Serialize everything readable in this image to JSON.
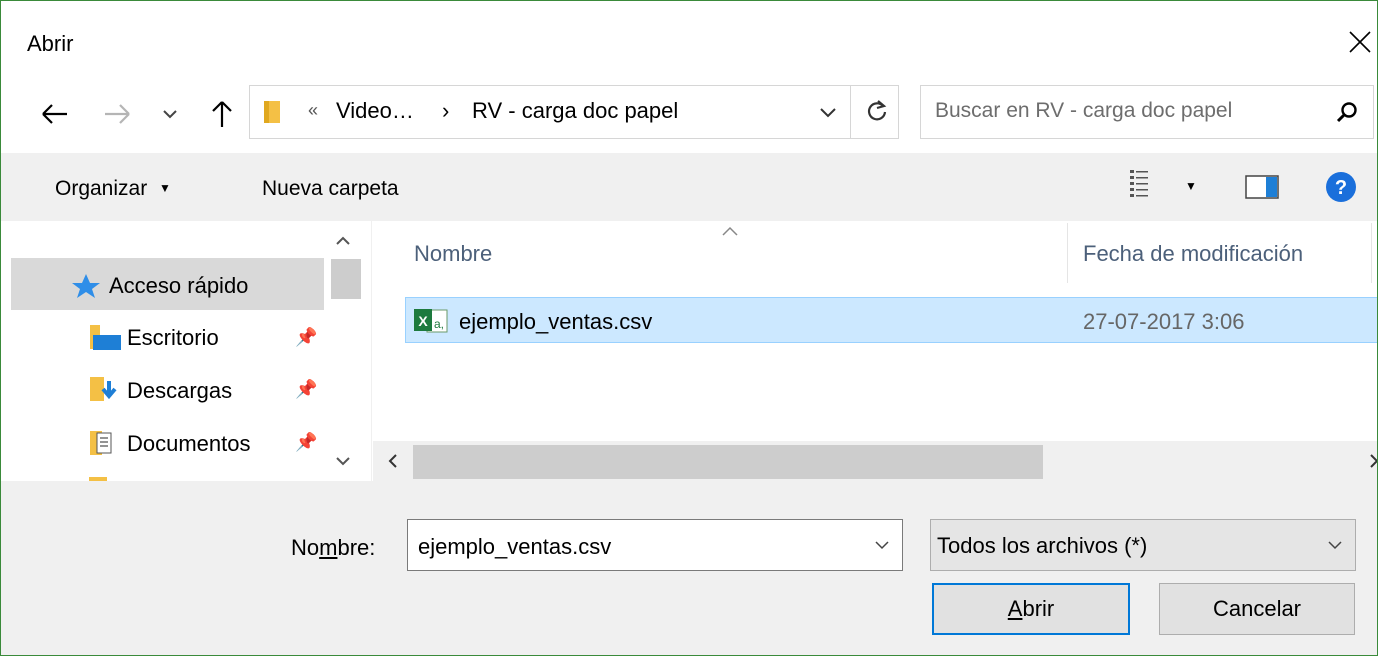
{
  "window": {
    "title": "Abrir"
  },
  "address": {
    "overflow": "«",
    "crumb1": "Video…",
    "crumb_sep": "›",
    "crumb2": "RV - carga doc papel"
  },
  "search": {
    "placeholder": "Buscar en RV - carga doc papel"
  },
  "toolbar": {
    "organize_label": "Organizar",
    "new_folder_label": "Nueva carpeta"
  },
  "nav": {
    "quick_access": "Acceso rápido",
    "items": [
      {
        "label": "Escritorio",
        "icon": "desktop-folder-icon",
        "pinned": true
      },
      {
        "label": "Descargas",
        "icon": "downloads-folder-icon",
        "pinned": true
      },
      {
        "label": "Documentos",
        "icon": "documents-folder-icon",
        "pinned": true
      }
    ]
  },
  "file_list": {
    "columns": [
      "Nombre",
      "Fecha de modificación"
    ],
    "rows": [
      {
        "name": "ejemplo_ventas.csv",
        "date": "27-07-2017 3:06",
        "selected": true
      }
    ]
  },
  "footer": {
    "name_label_pre": "No",
    "name_label_mnemonic": "m",
    "name_label_post": "bre:",
    "name_value": "ejemplo_ventas.csv",
    "type_value": "Todos los archivos (*)",
    "open_label_mnemonic": "A",
    "open_label_rest": "brir",
    "cancel_label": "Cancelar"
  },
  "colors": {
    "selection": "#cce8ff",
    "accent": "#0078d7",
    "help": "#1a6fdb",
    "folder": "#f4c045"
  }
}
